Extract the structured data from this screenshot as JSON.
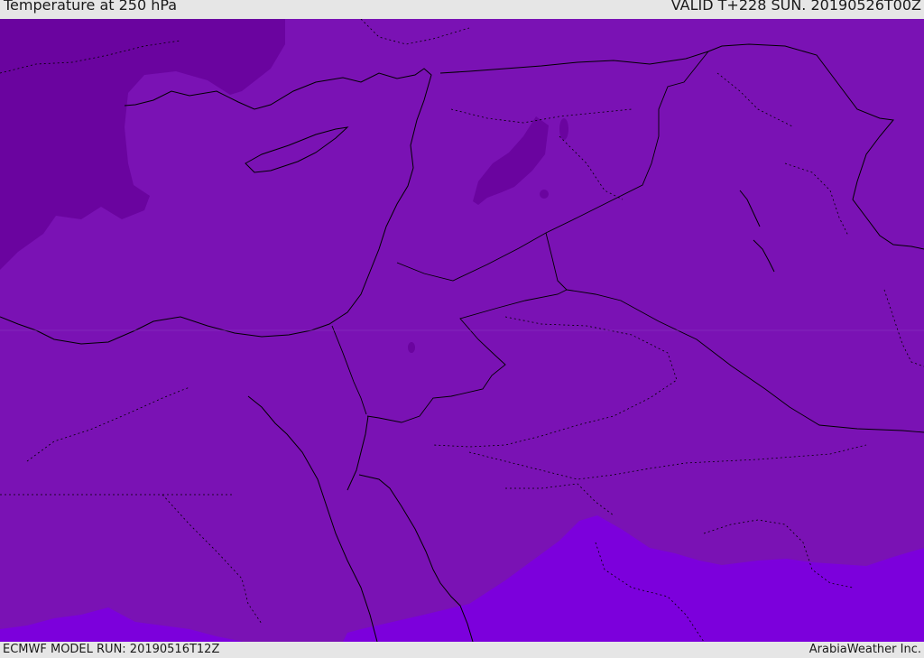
{
  "header": {
    "title": "Temperature at 250 hPa",
    "valid_time": "VALID T+228 SUN. 20190526T00Z"
  },
  "footer": {
    "model_run": "ECMWF MODEL RUN: 20190516T12Z",
    "credit": "ArabiaWeather Inc."
  },
  "colors": {
    "base_field": "#7a12b4",
    "cold_field": "#6a049f",
    "warm_field": "#7c00dc",
    "coastline": "#000000",
    "header_bg": "#e6e6e6"
  }
}
